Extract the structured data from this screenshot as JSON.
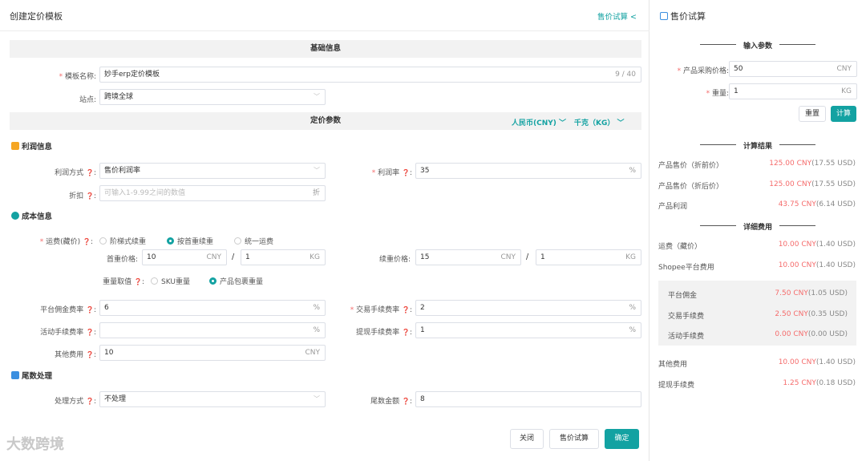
{
  "header": {
    "title": "创建定价模板",
    "calc_link": "售价试算 <"
  },
  "basic": {
    "title": "基础信息",
    "name_label": "模板名称:",
    "name_value": "妙手erp定价模板",
    "name_count": "9 / 40",
    "site_label": "站点:",
    "site_value": "跨境全球"
  },
  "pricing": {
    "title": "定价参数",
    "currency": "人民币(CNY)",
    "weight_unit": "千克（KG）"
  },
  "profit": {
    "title": "利润信息",
    "method_label": "利润方式",
    "method_value": "售价利润率",
    "rate_label": "利润率",
    "rate_value": "35",
    "rate_suffix": "%",
    "discount_label": "折扣",
    "discount_placeholder": "可输入1-9.99之间的数值",
    "discount_suffix": "折"
  },
  "cost": {
    "title": "成本信息",
    "ship_label": "运费(藏价)",
    "radio1": "阶梯式续重",
    "radio2": "按首重续重",
    "radio3": "统一运费",
    "first_label": "首重价格:",
    "first_price": "10",
    "first_cur": "CNY",
    "first_weight": "1",
    "first_unit": "KG",
    "cont_label": "续重价格:",
    "cont_price": "15",
    "cont_cur": "CNY",
    "cont_weight": "1",
    "cont_unit": "KG",
    "slash": "/",
    "weight_label": "重量取值",
    "wradio1": "SKU重量",
    "wradio2": "产品包裹重量",
    "platform_label": "平台佣金费率",
    "platform_value": "6",
    "trade_label": "交易手续费率",
    "trade_value": "2",
    "activity_label": "活动手续费率",
    "activity_value": "",
    "withdraw_label": "提现手续费率",
    "withdraw_value": "1",
    "pct": "%",
    "other_label": "其他费用",
    "other_value": "10",
    "other_cur": "CNY"
  },
  "rounding": {
    "title": "尾数处理",
    "method_label": "处理方式",
    "method_value": "不处理",
    "amount_label": "尾数金额",
    "amount_value": "8"
  },
  "buttons": {
    "close": "关闭",
    "calc": "售价试算",
    "confirm": "确定"
  },
  "watermark": "大数跨境",
  "side": {
    "title": "售价试算",
    "input_title": "输入参数",
    "cost_label": "产品采购价格:",
    "cost_value": "50",
    "cost_cur": "CNY",
    "weight_label": "重量:",
    "weight_value": "1",
    "weight_unit": "KG",
    "reset": "重置",
    "compute": "计算",
    "result_title": "计算结果",
    "results": [
      {
        "label": "产品售价（折前价）",
        "cny": "125.00 CNY",
        "usd": "(17.55 USD)"
      },
      {
        "label": "产品售价（折后价）",
        "cny": "125.00 CNY",
        "usd": "(17.55 USD)"
      },
      {
        "label": "产品利润",
        "cny": "43.75 CNY",
        "usd": "(6.14 USD)"
      }
    ],
    "fee_title": "详细费用",
    "fees": [
      {
        "label": "运费（藏价）",
        "cny": "10.00 CNY",
        "usd": "(1.40 USD)"
      },
      {
        "label": "Shopee平台费用",
        "cny": "10.00 CNY",
        "usd": "(1.40 USD)"
      }
    ],
    "subfees": [
      {
        "label": "平台佣金",
        "cny": "7.50 CNY",
        "usd": "(1.05 USD)"
      },
      {
        "label": "交易手续费",
        "cny": "2.50 CNY",
        "usd": "(0.35 USD)"
      },
      {
        "label": "活动手续费",
        "cny": "0.00 CNY",
        "usd": "(0.00 USD)"
      }
    ],
    "fees2": [
      {
        "label": "其他费用",
        "cny": "10.00 CNY",
        "usd": "(1.40 USD)"
      },
      {
        "label": "提现手续费",
        "cny": "1.25 CNY",
        "usd": "(0.18 USD)"
      }
    ]
  }
}
